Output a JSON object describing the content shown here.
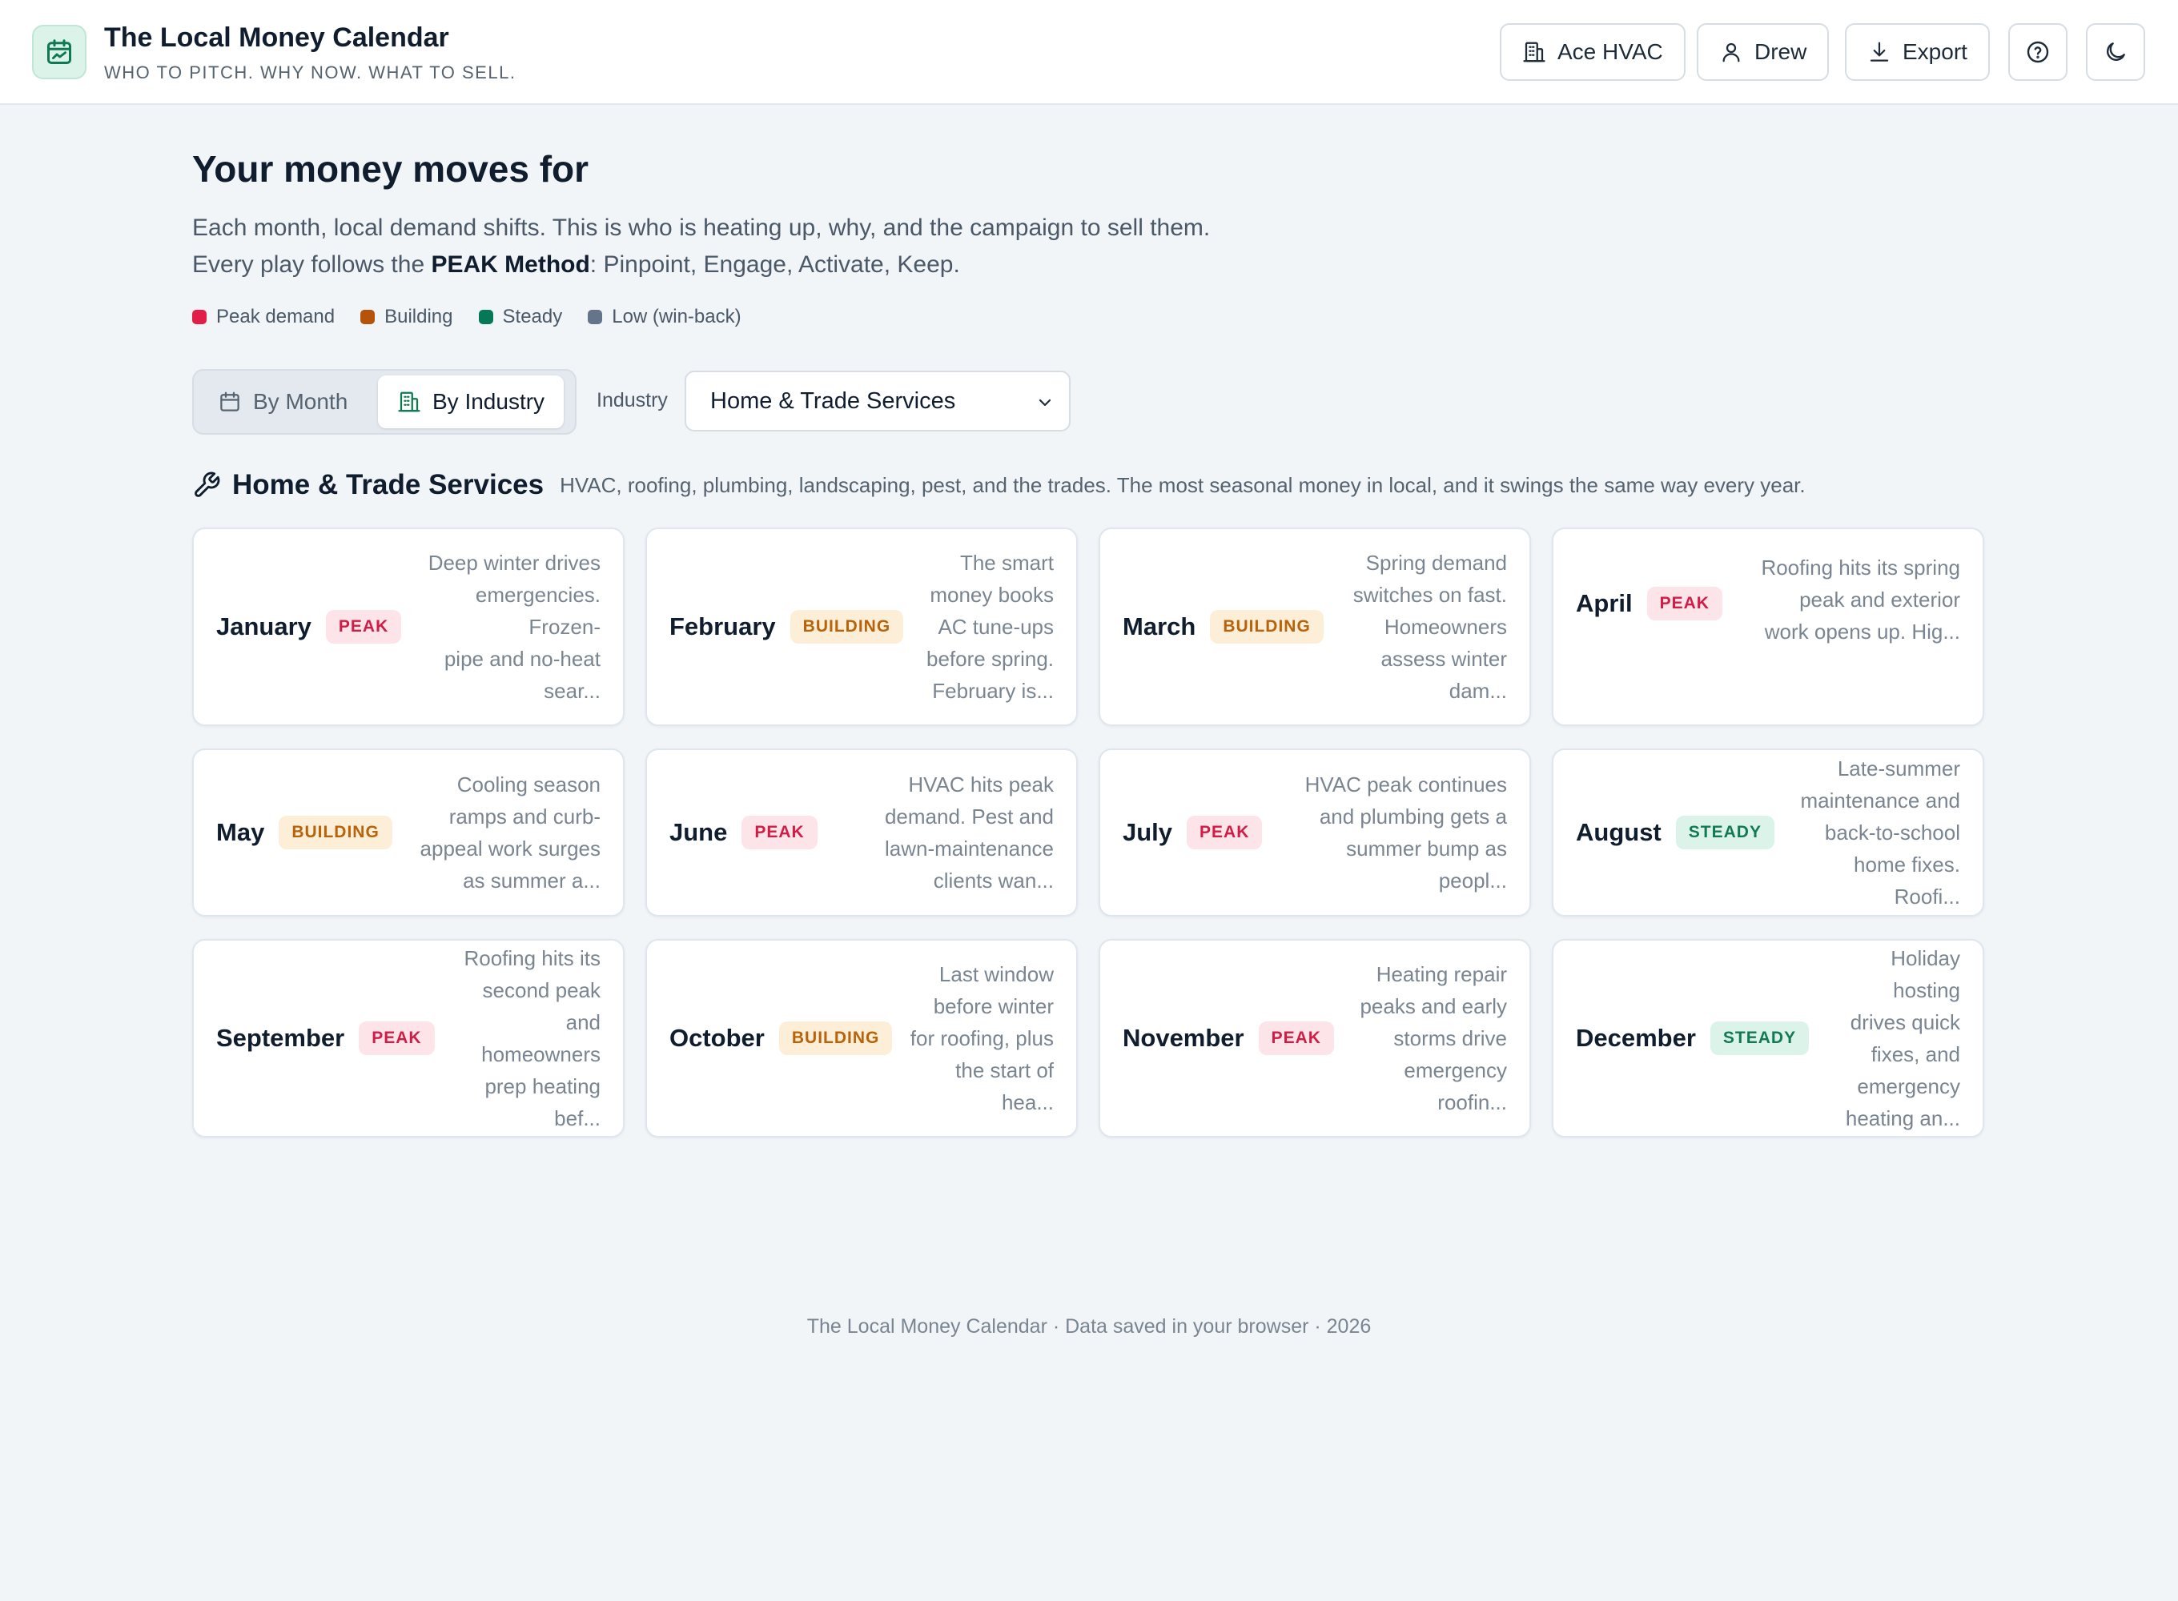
{
  "header": {
    "title": "The Local Money Calendar",
    "tagline": "WHO TO PITCH. WHY NOW. WHAT TO SELL.",
    "business_button": "Ace HVAC",
    "user_button": "Drew",
    "export_button": "Export"
  },
  "intro": {
    "heading": "Your money moves for",
    "line1": "Each month, local demand shifts. This is who is heating up, why, and the campaign to sell them.",
    "line2_prefix": "Every play follows the ",
    "line2_method": "PEAK Method",
    "line2_suffix": ": Pinpoint, Engage, Activate, Keep."
  },
  "legend": [
    {
      "label": "Peak demand",
      "color": "#e11d48"
    },
    {
      "label": "Building",
      "color": "#b45309"
    },
    {
      "label": "Steady",
      "color": "#047857"
    },
    {
      "label": "Low (win-back)",
      "color": "#64748b"
    }
  ],
  "view_toggle": {
    "by_month": "By Month",
    "by_industry": "By Industry",
    "selected": "By Industry"
  },
  "industry_select": {
    "label": "Industry",
    "value": "Home & Trade Services"
  },
  "section": {
    "title": "Home & Trade Services",
    "description": "HVAC, roofing, plumbing, landscaping, pest, and the trades. The most seasonal money in local, and it swings the same way every year."
  },
  "months": [
    {
      "month": "January",
      "badge": "PEAK",
      "status": "peak",
      "lines": [
        "Deep winter drives",
        "emergencies. Frozen-",
        "pipe and no-heat",
        "sear..."
      ]
    },
    {
      "month": "February",
      "badge": "BUILDING",
      "status": "building",
      "lines": [
        "The smart",
        "money books",
        "AC tune-ups",
        "before spring.",
        "February is..."
      ]
    },
    {
      "month": "March",
      "badge": "BUILDING",
      "status": "building",
      "lines": [
        "Spring demand",
        "switches on fast.",
        "Homeowners",
        "assess winter",
        "dam..."
      ]
    },
    {
      "month": "April",
      "badge": "PEAK",
      "status": "peak",
      "lines": [
        "Roofing hits its spring",
        "peak and exterior",
        "work opens up. Hig..."
      ]
    },
    {
      "month": "May",
      "badge": "BUILDING",
      "status": "building",
      "lines": [
        "Cooling season",
        "ramps and curb-",
        "appeal work surges",
        "as summer a..."
      ]
    },
    {
      "month": "June",
      "badge": "PEAK",
      "status": "peak",
      "lines": [
        "HVAC hits peak",
        "demand. Pest and",
        "lawn-maintenance",
        "clients wan..."
      ]
    },
    {
      "month": "July",
      "badge": "PEAK",
      "status": "peak",
      "lines": [
        "HVAC peak continues",
        "and plumbing gets a",
        "summer bump as",
        "peopl..."
      ]
    },
    {
      "month": "August",
      "badge": "STEADY",
      "status": "steady",
      "lines": [
        "Late-summer",
        "maintenance and",
        "back-to-school",
        "home fixes. Roofi..."
      ]
    },
    {
      "month": "September",
      "badge": "PEAK",
      "status": "peak",
      "lines": [
        "Roofing hits its",
        "second peak and",
        "homeowners",
        "prep heating",
        "bef..."
      ]
    },
    {
      "month": "October",
      "badge": "BUILDING",
      "status": "building",
      "lines": [
        "Last window",
        "before winter",
        "for roofing, plus",
        "the start of",
        "hea..."
      ]
    },
    {
      "month": "November",
      "badge": "PEAK",
      "status": "peak",
      "lines": [
        "Heating repair",
        "peaks and early",
        "storms drive",
        "emergency",
        "roofin..."
      ]
    },
    {
      "month": "December",
      "badge": "STEADY",
      "status": "steady",
      "lines": [
        "Holiday hosting",
        "drives quick",
        "fixes, and",
        "emergency",
        "heating an..."
      ]
    }
  ],
  "footer": "The Local Money Calendar · Data saved in your browser · 2026"
}
